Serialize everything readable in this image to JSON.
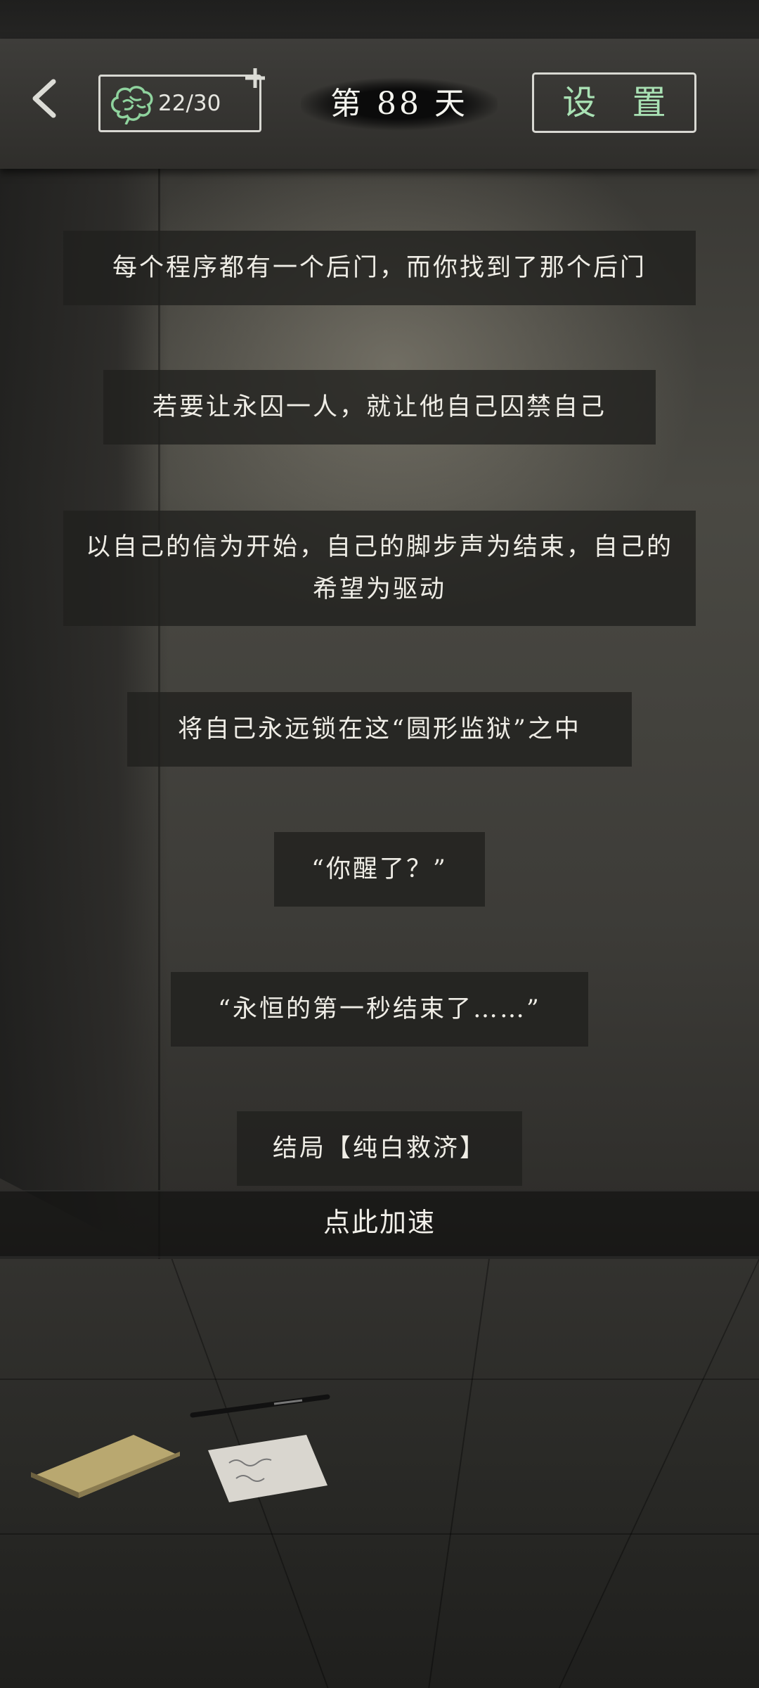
{
  "top_bar": {
    "brain_count": "22/30",
    "day_label": "第 88 天",
    "settings_label": "设 置"
  },
  "story": [
    "每个程序都有一个后门，而你找到了那个后门",
    "若要让永囚一人，就让他自己囚禁自己",
    "以自己的信为开始，自己的脚步声为结束，自己的希望为驱动",
    "将自己永远锁在这“圆形监狱”之中",
    "“你醒了？”",
    "“永恒的第一秒结束了……”",
    "结局【纯白救济】"
  ],
  "speed_up_label": "点此加速",
  "icons": {
    "back": "chevron-left-icon",
    "brain": "brain-icon",
    "plus": "plus-icon"
  },
  "colors": {
    "settings_text": "#a9e1b4",
    "brain_icon": "#8fd39e"
  }
}
